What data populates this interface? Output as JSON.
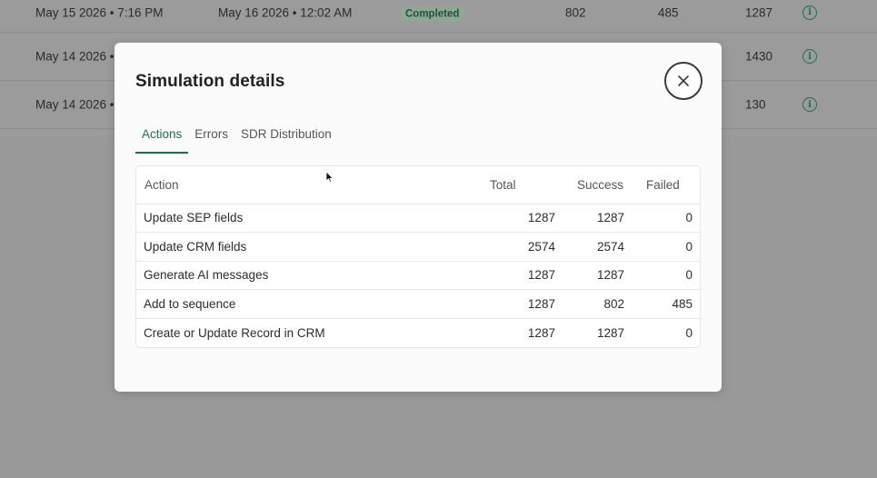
{
  "background_table": {
    "rows": [
      {
        "start": "May 15 2026 • 7:16 PM",
        "end": "May 16 2026 • 12:02 AM",
        "status": "Completed",
        "a": "802",
        "b": "485",
        "c": "1287"
      },
      {
        "start": "May 14 2026 •",
        "end": "",
        "status": "",
        "a": "",
        "b": "",
        "c": "1430"
      },
      {
        "start": "May 14 2026 •",
        "end": "",
        "status": "",
        "a": "",
        "b": "",
        "c": "130"
      }
    ]
  },
  "modal": {
    "title": "Simulation details",
    "tabs": [
      {
        "label": "Actions",
        "active": true
      },
      {
        "label": "Errors",
        "active": false
      },
      {
        "label": "SDR Distribution",
        "active": false
      }
    ],
    "table": {
      "headers": {
        "action": "Action",
        "total": "Total",
        "success": "Success",
        "failed": "Failed"
      },
      "rows": [
        {
          "action": "Update SEP fields",
          "total": "1287",
          "success": "1287",
          "failed": "0"
        },
        {
          "action": "Update CRM fields",
          "total": "2574",
          "success": "2574",
          "failed": "0"
        },
        {
          "action": "Generate AI messages",
          "total": "1287",
          "success": "1287",
          "failed": "0"
        },
        {
          "action": "Add to sequence",
          "total": "1287",
          "success": "802",
          "failed": "485"
        },
        {
          "action": "Create or Update Record in CRM",
          "total": "1287",
          "success": "1287",
          "failed": "0"
        }
      ]
    }
  },
  "icons": {
    "close": "close-icon",
    "info": "info-icon",
    "cursor": "mouse-pointer-icon"
  },
  "colors": {
    "accent": "#1f6e4c",
    "overlay": "#9b9b9b"
  }
}
